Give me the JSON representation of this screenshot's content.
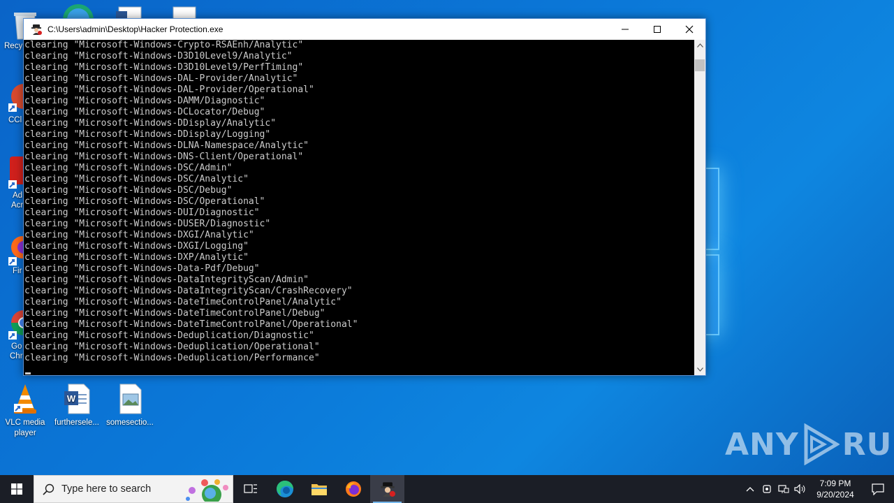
{
  "window": {
    "title": "C:\\Users\\admin\\Desktop\\Hacker Protection.exe"
  },
  "console": {
    "lines": [
      "clearing \"Microsoft-Windows-Crypto-RSAEnh/Analytic\"",
      "clearing \"Microsoft-Windows-D3D10Level9/Analytic\"",
      "clearing \"Microsoft-Windows-D3D10Level9/PerfTiming\"",
      "clearing \"Microsoft-Windows-DAL-Provider/Analytic\"",
      "clearing \"Microsoft-Windows-DAL-Provider/Operational\"",
      "clearing \"Microsoft-Windows-DAMM/Diagnostic\"",
      "clearing \"Microsoft-Windows-DCLocator/Debug\"",
      "clearing \"Microsoft-Windows-DDisplay/Analytic\"",
      "clearing \"Microsoft-Windows-DDisplay/Logging\"",
      "clearing \"Microsoft-Windows-DLNA-Namespace/Analytic\"",
      "clearing \"Microsoft-Windows-DNS-Client/Operational\"",
      "clearing \"Microsoft-Windows-DSC/Admin\"",
      "clearing \"Microsoft-Windows-DSC/Analytic\"",
      "clearing \"Microsoft-Windows-DSC/Debug\"",
      "clearing \"Microsoft-Windows-DSC/Operational\"",
      "clearing \"Microsoft-Windows-DUI/Diagnostic\"",
      "clearing \"Microsoft-Windows-DUSER/Diagnostic\"",
      "clearing \"Microsoft-Windows-DXGI/Analytic\"",
      "clearing \"Microsoft-Windows-DXGI/Logging\"",
      "clearing \"Microsoft-Windows-DXP/Analytic\"",
      "clearing \"Microsoft-Windows-Data-Pdf/Debug\"",
      "clearing \"Microsoft-Windows-DataIntegrityScan/Admin\"",
      "clearing \"Microsoft-Windows-DataIntegrityScan/CrashRecovery\"",
      "clearing \"Microsoft-Windows-DateTimeControlPanel/Analytic\"",
      "clearing \"Microsoft-Windows-DateTimeControlPanel/Debug\"",
      "clearing \"Microsoft-Windows-DateTimeControlPanel/Operational\"",
      "clearing \"Microsoft-Windows-Deduplication/Diagnostic\"",
      "clearing \"Microsoft-Windows-Deduplication/Operational\"",
      "clearing \"Microsoft-Windows-Deduplication/Performance\""
    ]
  },
  "desktop": {
    "partial_labels": [
      "Recy",
      "CCl",
      "Ad",
      "Acr",
      "Fir",
      "Go",
      "Chr"
    ],
    "icons": [
      {
        "label_line1": "VLC media",
        "label_line2": "player",
        "icon": "vlc-icon"
      },
      {
        "label_line1": "furthersele...",
        "label_line2": "",
        "icon": "word-doc-icon"
      },
      {
        "label_line1": "somesectio...",
        "label_line2": "",
        "icon": "image-file-icon"
      }
    ]
  },
  "watermark": {
    "left": "ANY",
    "right": "RUN"
  },
  "taskbar": {
    "search_placeholder": "Type here to search",
    "time": "7:09 PM",
    "date": "9/20/2024"
  },
  "colors": {
    "console_text": "#cccccc",
    "taskbar_bg": "#1b1e26",
    "accent": "#76b9ed"
  }
}
